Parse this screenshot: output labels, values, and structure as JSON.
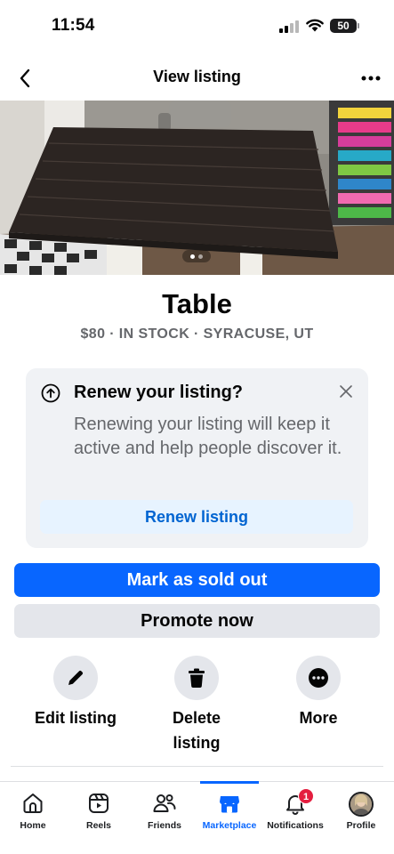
{
  "status_bar": {
    "time": "11:54",
    "battery": "50"
  },
  "header": {
    "title": "View listing",
    "back_icon": "chevron-left-icon",
    "more_icon": "more-horizontal-icon"
  },
  "listing": {
    "title": "Table",
    "price": "$80",
    "stock": "IN STOCK",
    "location": "SYRACUSE, UT",
    "meta": "$80 · IN STOCK · SYRACUSE, UT",
    "photo_count": 2,
    "photo_index": 1
  },
  "renew_card": {
    "heading": "Renew your listing?",
    "body": "Renewing your listing will keep it active and help people discover it.",
    "button": "Renew listing"
  },
  "actions": {
    "mark_sold": "Mark as sold out",
    "promote": "Promote now",
    "edit": "Edit listing",
    "delete_line1": "Delete",
    "delete_line2": "listing",
    "more": "More"
  },
  "tabs": [
    {
      "label": "Home",
      "icon": "home-icon"
    },
    {
      "label": "Reels",
      "icon": "reels-icon"
    },
    {
      "label": "Friends",
      "icon": "friends-icon"
    },
    {
      "label": "Marketplace",
      "icon": "marketplace-icon",
      "active": true
    },
    {
      "label": "Notifications",
      "icon": "bell-icon",
      "badge": "1"
    },
    {
      "label": "Profile",
      "icon": "avatar"
    }
  ],
  "colors": {
    "accent": "#0866ff",
    "accent_text": "#0064d1",
    "badge": "#e41e3f",
    "secondary_text": "#65676b"
  }
}
